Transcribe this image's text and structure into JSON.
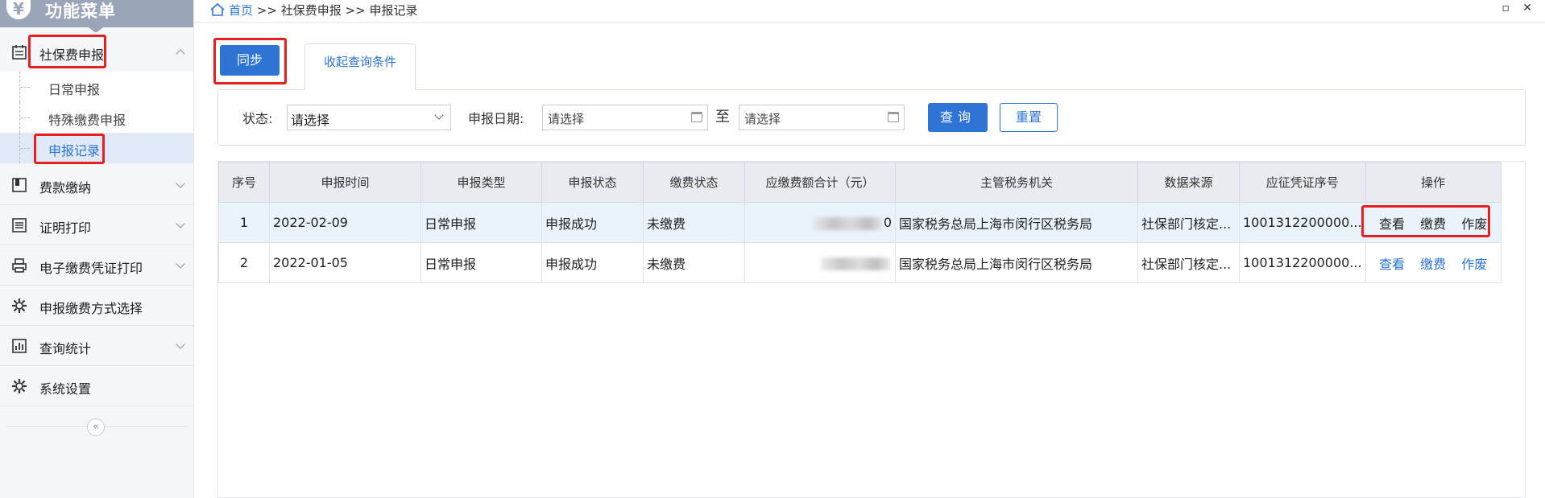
{
  "sidebar": {
    "title": "功能菜单",
    "yen": "¥",
    "menu": [
      {
        "label": "社保费申报",
        "icon": "calendar-icon",
        "expanded": true
      },
      {
        "label": "费款缴纳",
        "icon": "book-icon"
      },
      {
        "label": "证明打印",
        "icon": "document-list-icon"
      },
      {
        "label": "电子缴费凭证打印",
        "icon": "printer-icon"
      },
      {
        "label": "申报缴费方式选择",
        "icon": "gear-icon"
      },
      {
        "label": "查询统计",
        "icon": "bar-chart-icon"
      },
      {
        "label": "系统设置",
        "icon": "gear-icon"
      }
    ],
    "submenu": [
      "日常申报",
      "特殊缴费申报",
      "申报记录"
    ],
    "active_submenu": "申报记录",
    "collapse_glyph": "«"
  },
  "breadcrumb": {
    "home": "首页",
    "sep": ">>",
    "level1": "社保费申报",
    "level2": "申报记录"
  },
  "window_buttons": "▫ ✕",
  "toolbar": {
    "sync_label": "同步",
    "collapse_tab_label": "收起查询条件"
  },
  "filters": {
    "status_label": "状态:",
    "status_value": "请选择",
    "date_label": "申报日期:",
    "date_from_placeholder": "请选择",
    "to_label": "至",
    "date_to_placeholder": "请选择",
    "query_label": "查询",
    "reset_label": "重置"
  },
  "table": {
    "columns": [
      "序号",
      "申报时间",
      "申报类型",
      "申报状态",
      "缴费状态",
      "应缴费额合计（元）",
      "主管税务机关",
      "数据来源",
      "应征凭证序号",
      "操作"
    ],
    "rows": [
      {
        "no": "1",
        "date": "2022-02-09",
        "type": "日常申报",
        "status": "申报成功",
        "pay_status": "未缴费",
        "amount_tail": "0",
        "office": "国家税务总局上海市闵行区税务局",
        "source": "社保部门核定...",
        "voucher": "1001312200000...",
        "actions": [
          "查看",
          "缴费",
          "作废"
        ]
      },
      {
        "no": "2",
        "date": "2022-01-05",
        "type": "日常申报",
        "status": "申报成功",
        "pay_status": "未缴费",
        "amount_tail": "",
        "office": "国家税务总局上海市闵行区税务局",
        "source": "社保部门核定...",
        "voucher": "1001312200000...",
        "actions": [
          "查看",
          "缴费",
          "作废"
        ]
      }
    ]
  },
  "colors": {
    "accent": "#2e74d4",
    "highlight_border": "#e81f1f",
    "sidebar_header": "#9aa6b8"
  }
}
